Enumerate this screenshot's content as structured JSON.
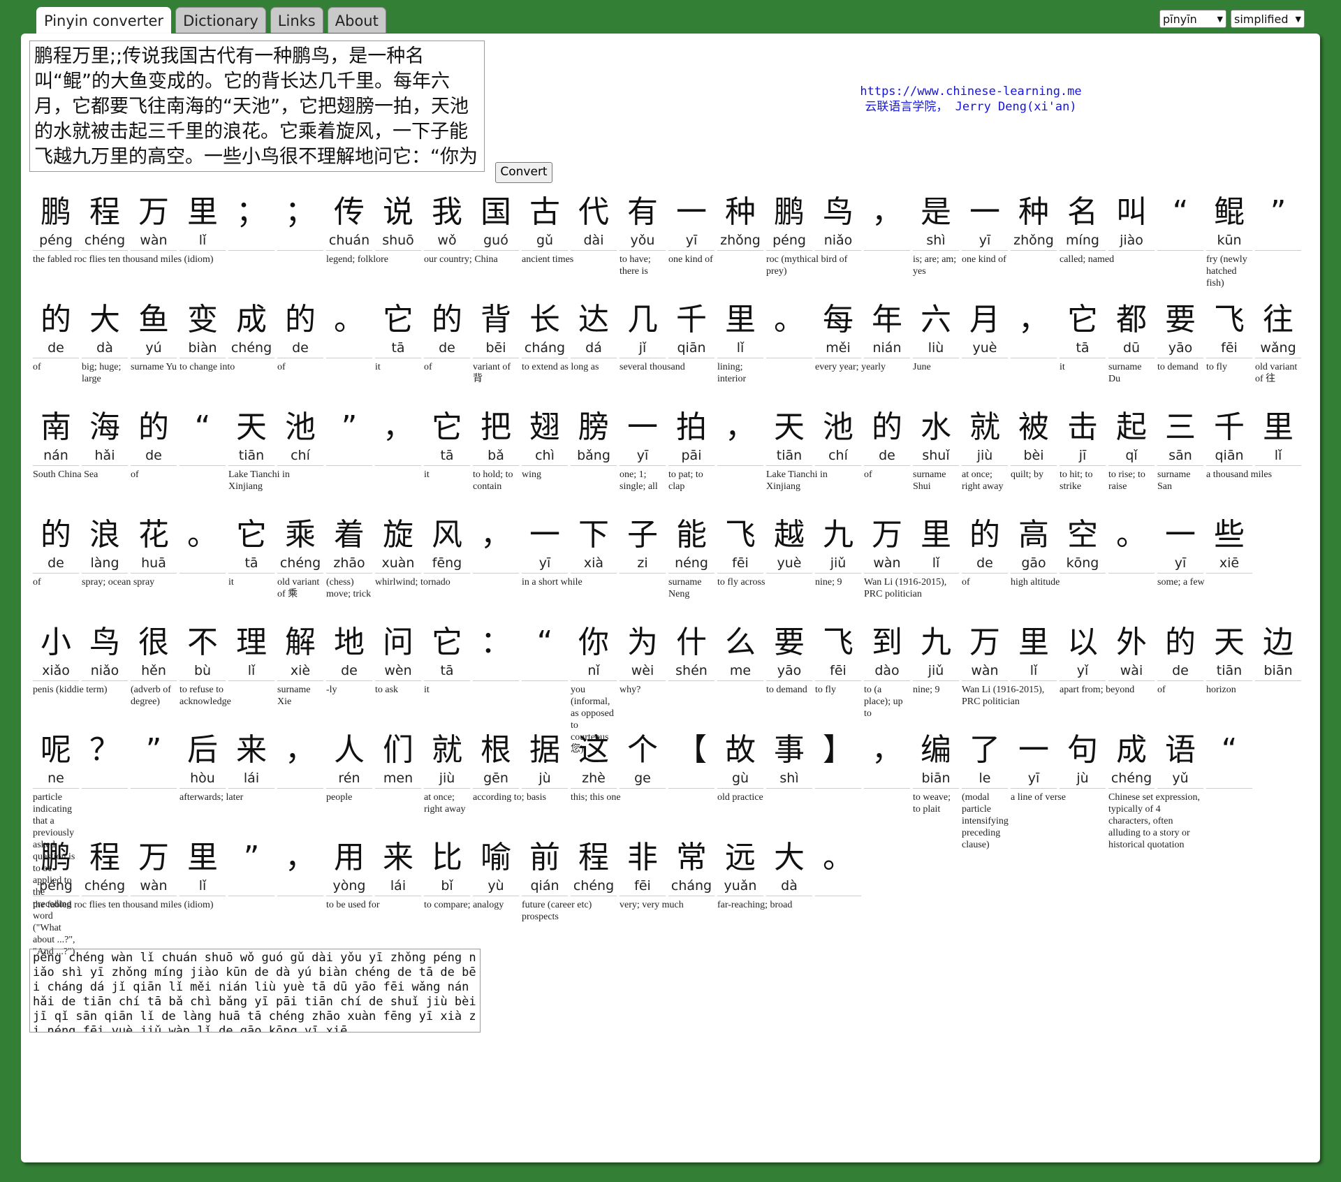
{
  "tabs": [
    "Pinyin converter",
    "Dictionary",
    "Links",
    "About"
  ],
  "selects": {
    "mode": "pīnyīn",
    "script": "simplified"
  },
  "input_text": "鹏程万里;;传说我国古代有一种鹏鸟，是一种名叫“鲲”的大鱼变成的。它的背长达几千里。每年六月，它都要飞往南海的“天池”，它把翅膀一拍，天池的水就被击起三千里的浪花。它乘着旋风，一下子能飞越九万里的高空。一些小鸟很不理解地问它：“你为什么要飞到九万里以外的天边呢？”后来，人们就根据这个【故事】，编了一句成语“",
  "convert_label": "Convert",
  "credit": {
    "url": "https://www.chinese-learning.me",
    "author": "云联语言学院， Jerry Deng(xi'an)"
  },
  "rows": [
    [
      {
        "h": "鹏",
        "p": "péng",
        "g": "the fabled roc flies ten thousand miles (idiom)",
        "s": 4
      },
      {
        "h": "程",
        "p": "chéng"
      },
      {
        "h": "万",
        "p": "wàn"
      },
      {
        "h": "里",
        "p": "lǐ"
      },
      {
        "h": "；",
        "p": ""
      },
      {
        "h": "；",
        "p": ""
      },
      {
        "h": "传",
        "p": "chuán",
        "g": "legend; folklore",
        "s": 2
      },
      {
        "h": "说",
        "p": "shuō"
      },
      {
        "h": "我",
        "p": "wǒ",
        "g": "our country; China",
        "s": 2
      },
      {
        "h": "国",
        "p": "guó"
      },
      {
        "h": "古",
        "p": "gǔ",
        "g": "ancient times",
        "s": 2
      },
      {
        "h": "代",
        "p": "dài"
      },
      {
        "h": "有",
        "p": "yǒu",
        "g": "to have; there is"
      },
      {
        "h": "一",
        "p": "yī",
        "g": "one kind of",
        "s": 2
      },
      {
        "h": "种",
        "p": "zhǒng"
      },
      {
        "h": "鹏",
        "p": "péng",
        "g": "roc (mythical bird of prey)",
        "s": 2
      },
      {
        "h": "鸟",
        "p": "niǎo"
      },
      {
        "h": "，",
        "p": ""
      },
      {
        "h": "是",
        "p": "shì",
        "g": "is; are; am; yes"
      },
      {
        "h": "一",
        "p": "yī",
        "g": "one kind of",
        "s": 2
      },
      {
        "h": "种",
        "p": "zhǒng"
      },
      {
        "h": "名",
        "p": "míng",
        "g": "called; named",
        "s": 2
      },
      {
        "h": "叫",
        "p": "jiào"
      },
      {
        "h": "“",
        "p": ""
      },
      {
        "h": "鲲",
        "p": "kūn",
        "g": "fry (newly hatched fish)"
      },
      {
        "h": "”",
        "p": ""
      }
    ],
    [
      {
        "h": "的",
        "p": "de",
        "g": "of"
      },
      {
        "h": "大",
        "p": "dà",
        "g": "big; huge; large"
      },
      {
        "h": "鱼",
        "p": "yú",
        "g": "surname Yu"
      },
      {
        "h": "变",
        "p": "biàn",
        "g": "to change into",
        "s": 2
      },
      {
        "h": "成",
        "p": "chéng"
      },
      {
        "h": "的",
        "p": "de",
        "g": "of"
      },
      {
        "h": "。",
        "p": ""
      },
      {
        "h": "它",
        "p": "tā",
        "g": "it"
      },
      {
        "h": "的",
        "p": "de",
        "g": "of"
      },
      {
        "h": "背",
        "p": "bēi",
        "g": "variant of 背"
      },
      {
        "h": "长",
        "p": "cháng",
        "g": "to extend as long as",
        "s": 2
      },
      {
        "h": "达",
        "p": "dá"
      },
      {
        "h": "几",
        "p": "jǐ",
        "g": "several thousand",
        "s": 2
      },
      {
        "h": "千",
        "p": "qiān"
      },
      {
        "h": "里",
        "p": "lǐ",
        "g": "lining; interior"
      },
      {
        "h": "。",
        "p": ""
      },
      {
        "h": "每",
        "p": "měi",
        "g": "every year; yearly",
        "s": 2
      },
      {
        "h": "年",
        "p": "nián"
      },
      {
        "h": "六",
        "p": "liù",
        "g": "June",
        "s": 2
      },
      {
        "h": "月",
        "p": "yuè"
      },
      {
        "h": "，",
        "p": ""
      },
      {
        "h": "它",
        "p": "tā",
        "g": "it"
      },
      {
        "h": "都",
        "p": "dū",
        "g": "surname Du"
      },
      {
        "h": "要",
        "p": "yāo",
        "g": "to demand"
      },
      {
        "h": "飞",
        "p": "fēi",
        "g": "to fly"
      },
      {
        "h": "往",
        "p": "wǎng",
        "g": "old variant of 往"
      }
    ],
    [
      {
        "h": "南",
        "p": "nán",
        "g": "South China Sea",
        "s": 2
      },
      {
        "h": "海",
        "p": "hǎi"
      },
      {
        "h": "的",
        "p": "de",
        "g": "of"
      },
      {
        "h": "“",
        "p": ""
      },
      {
        "h": "天",
        "p": "tiān",
        "g": "Lake Tianchi in Xinjiang",
        "s": 2
      },
      {
        "h": "池",
        "p": "chí"
      },
      {
        "h": "”",
        "p": ""
      },
      {
        "h": "，",
        "p": ""
      },
      {
        "h": "它",
        "p": "tā",
        "g": "it"
      },
      {
        "h": "把",
        "p": "bǎ",
        "g": "to hold; to contain"
      },
      {
        "h": "翅",
        "p": "chì",
        "g": "wing",
        "s": 2
      },
      {
        "h": "膀",
        "p": "bǎng"
      },
      {
        "h": "一",
        "p": "yī",
        "g": "one; 1; single; all"
      },
      {
        "h": "拍",
        "p": "pāi",
        "g": "to pat; to clap"
      },
      {
        "h": "，",
        "p": ""
      },
      {
        "h": "天",
        "p": "tiān",
        "g": "Lake Tianchi in Xinjiang",
        "s": 2
      },
      {
        "h": "池",
        "p": "chí"
      },
      {
        "h": "的",
        "p": "de",
        "g": "of"
      },
      {
        "h": "水",
        "p": "shuǐ",
        "g": "surname Shui"
      },
      {
        "h": "就",
        "p": "jiù",
        "g": "at once; right away"
      },
      {
        "h": "被",
        "p": "bèi",
        "g": "quilt; by"
      },
      {
        "h": "击",
        "p": "jī",
        "g": "to hit; to strike"
      },
      {
        "h": "起",
        "p": "qǐ",
        "g": "to rise; to raise"
      },
      {
        "h": "三",
        "p": "sān",
        "g": "surname San"
      },
      {
        "h": "千",
        "p": "qiān",
        "g": "a thousand miles",
        "s": 2
      },
      {
        "h": "里",
        "p": "lǐ"
      }
    ],
    [
      {
        "h": "的",
        "p": "de",
        "g": "of"
      },
      {
        "h": "浪",
        "p": "làng",
        "g": "spray; ocean spray",
        "s": 2
      },
      {
        "h": "花",
        "p": "huā"
      },
      {
        "h": "。",
        "p": ""
      },
      {
        "h": "它",
        "p": "tā",
        "g": "it"
      },
      {
        "h": "乘",
        "p": "chéng",
        "g": "old variant of 乘"
      },
      {
        "h": "着",
        "p": "zhāo",
        "g": "(chess) move; trick"
      },
      {
        "h": "旋",
        "p": "xuàn",
        "g": "whirlwind; tornado",
        "s": 2
      },
      {
        "h": "风",
        "p": "fēng"
      },
      {
        "h": "，",
        "p": ""
      },
      {
        "h": "一",
        "p": "yī",
        "g": "in a short while",
        "s": 3
      },
      {
        "h": "下",
        "p": "xià"
      },
      {
        "h": "子",
        "p": "zi"
      },
      {
        "h": "能",
        "p": "néng",
        "g": "surname Neng"
      },
      {
        "h": "飞",
        "p": "fēi",
        "g": "to fly across",
        "s": 2
      },
      {
        "h": "越",
        "p": "yuè"
      },
      {
        "h": "九",
        "p": "jiǔ",
        "g": "nine; 9"
      },
      {
        "h": "万",
        "p": "wàn",
        "g": "Wan Li (1916-2015), PRC politician",
        "s": 2
      },
      {
        "h": "里",
        "p": "lǐ"
      },
      {
        "h": "的",
        "p": "de",
        "g": "of"
      },
      {
        "h": "高",
        "p": "gāo",
        "g": "high altitude",
        "s": 2
      },
      {
        "h": "空",
        "p": "kōng"
      },
      {
        "h": "。",
        "p": ""
      },
      {
        "h": "一",
        "p": "yī",
        "g": "some; a few",
        "s": 2
      },
      {
        "h": "些",
        "p": "xiē"
      }
    ],
    [
      {
        "h": "小",
        "p": "xiǎo",
        "g": "penis (kiddie term)",
        "s": 2
      },
      {
        "h": "鸟",
        "p": "niǎo"
      },
      {
        "h": "很",
        "p": "hěn",
        "g": "(adverb of degree)"
      },
      {
        "h": "不",
        "p": "bù",
        "g": "to refuse to acknowledge",
        "s": 2
      },
      {
        "h": "理",
        "p": "lǐ"
      },
      {
        "h": "解",
        "p": "xiè",
        "g": "surname Xie"
      },
      {
        "h": "地",
        "p": "de",
        "g": "-ly"
      },
      {
        "h": "问",
        "p": "wèn",
        "g": "to ask"
      },
      {
        "h": "它",
        "p": "tā",
        "g": "it"
      },
      {
        "h": "：",
        "p": ""
      },
      {
        "h": "“",
        "p": ""
      },
      {
        "h": "你",
        "p": "nǐ",
        "g": "you (informal, as opposed to courteous 您)"
      },
      {
        "h": "为",
        "p": "wèi",
        "g": "why?",
        "s": 3
      },
      {
        "h": "什",
        "p": "shén"
      },
      {
        "h": "么",
        "p": "me"
      },
      {
        "h": "要",
        "p": "yāo",
        "g": "to demand"
      },
      {
        "h": "飞",
        "p": "fēi",
        "g": "to fly"
      },
      {
        "h": "到",
        "p": "dào",
        "g": "to (a place); up to"
      },
      {
        "h": "九",
        "p": "jiǔ",
        "g": "nine; 9"
      },
      {
        "h": "万",
        "p": "wàn",
        "g": "Wan Li (1916-2015), PRC politician",
        "s": 2
      },
      {
        "h": "里",
        "p": "lǐ"
      },
      {
        "h": "以",
        "p": "yǐ",
        "g": "apart from; beyond",
        "s": 2
      },
      {
        "h": "外",
        "p": "wài"
      },
      {
        "h": "的",
        "p": "de",
        "g": "of"
      },
      {
        "h": "天",
        "p": "tiān",
        "g": "horizon",
        "s": 2
      },
      {
        "h": "边",
        "p": "biān"
      }
    ],
    [
      {
        "h": "呢",
        "p": "ne",
        "g": "particle indicating that a previously asked question is to be applied to the preceding word (\"What about ...?\", \"And ...?\")"
      },
      {
        "h": "？",
        "p": ""
      },
      {
        "h": "”",
        "p": ""
      },
      {
        "h": "后",
        "p": "hòu",
        "g": "afterwards; later",
        "s": 2
      },
      {
        "h": "来",
        "p": "lái"
      },
      {
        "h": "，",
        "p": ""
      },
      {
        "h": "人",
        "p": "rén",
        "g": "people",
        "s": 2
      },
      {
        "h": "们",
        "p": "men"
      },
      {
        "h": "就",
        "p": "jiù",
        "g": "at once; right away"
      },
      {
        "h": "根",
        "p": "gēn",
        "g": "according to; basis",
        "s": 2
      },
      {
        "h": "据",
        "p": "jù"
      },
      {
        "h": "这",
        "p": "zhè",
        "g": "this; this one",
        "s": 2
      },
      {
        "h": "个",
        "p": "ge"
      },
      {
        "h": "【",
        "p": ""
      },
      {
        "h": "故",
        "p": "gù",
        "g": "old practice",
        "s": 2
      },
      {
        "h": "事",
        "p": "shì"
      },
      {
        "h": "】",
        "p": ""
      },
      {
        "h": "，",
        "p": ""
      },
      {
        "h": "编",
        "p": "biān",
        "g": "to weave; to plait"
      },
      {
        "h": "了",
        "p": "le",
        "g": "(modal particle intensifying preceding clause)"
      },
      {
        "h": "一",
        "p": "yī",
        "g": "a line of verse",
        "s": 2
      },
      {
        "h": "句",
        "p": "jù"
      },
      {
        "h": "成",
        "p": "chéng",
        "g": "Chinese set expression, typically of 4 characters, often alluding to a story or historical quotation",
        "s": 2
      },
      {
        "h": "语",
        "p": "yǔ"
      },
      {
        "h": "“",
        "p": ""
      }
    ],
    [
      {
        "h": "鹏",
        "p": "péng",
        "g": "the fabled roc flies ten thousand miles (idiom)",
        "s": 4
      },
      {
        "h": "程",
        "p": "chéng"
      },
      {
        "h": "万",
        "p": "wàn"
      },
      {
        "h": "里",
        "p": "lǐ"
      },
      {
        "h": "”",
        "p": ""
      },
      {
        "h": "，",
        "p": ""
      },
      {
        "h": "用",
        "p": "yòng",
        "g": "to be used for",
        "s": 2
      },
      {
        "h": "来",
        "p": "lái"
      },
      {
        "h": "比",
        "p": "bǐ",
        "g": "to compare; analogy",
        "s": 2
      },
      {
        "h": "喻",
        "p": "yù"
      },
      {
        "h": "前",
        "p": "qián",
        "g": "future (career etc) prospects",
        "s": 2
      },
      {
        "h": "程",
        "p": "chéng"
      },
      {
        "h": "非",
        "p": "fēi",
        "g": "very; very much",
        "s": 2
      },
      {
        "h": "常",
        "p": "cháng"
      },
      {
        "h": "远",
        "p": "yuǎn",
        "g": "far-reaching; broad",
        "s": 2
      },
      {
        "h": "大",
        "p": "dà"
      },
      {
        "h": "。",
        "p": ""
      }
    ]
  ],
  "output_text": "péng chéng wàn lǐ   chuán shuō wǒ guó gǔ dài yǒu yī zhǒng péng niǎo  shì yī zhǒng míng jiào  kūn  de dà yú biàn chéng de  tā de bēi cháng dá jǐ qiān lǐ  měi nián liù yuè  tā dū yāo fēi wǎng nán hǎi de  tiān chí   tā bǎ chì bǎng yī pāi  tiān chí de shuǐ jiù bèi jī qǐ sān qiān lǐ de làng huā  tā chéng zhāo xuàn fēng  yī xià zi néng fēi yuè jiǔ wàn lǐ de gāo kōng  yī xiē"
}
